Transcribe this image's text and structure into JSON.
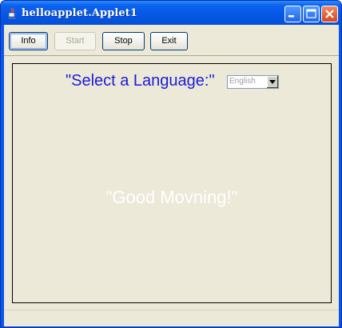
{
  "window": {
    "title": "helloapplet.Applet1",
    "app_icon": "java-cup-icon"
  },
  "title_controls": {
    "minimize_icon": "minimize-icon",
    "maximize_icon": "maximize-icon",
    "close_icon": "close-icon"
  },
  "toolbar": {
    "info_label": "Info",
    "start_label": "Start",
    "start_enabled": false,
    "stop_label": "Stop",
    "exit_label": "Exit"
  },
  "panel": {
    "prompt": "\"Select a Language:\"",
    "language_select": {
      "selected": "English",
      "arrow_icon": "chevron-down-icon"
    },
    "greeting": "\"Good Movning!\""
  },
  "colors": {
    "titlebar": "#0658e6",
    "client_background": "#ece9d8",
    "prompt_text": "#1c1cd6",
    "greeting_text": "#ffffff",
    "disabled_text": "#aca899"
  }
}
